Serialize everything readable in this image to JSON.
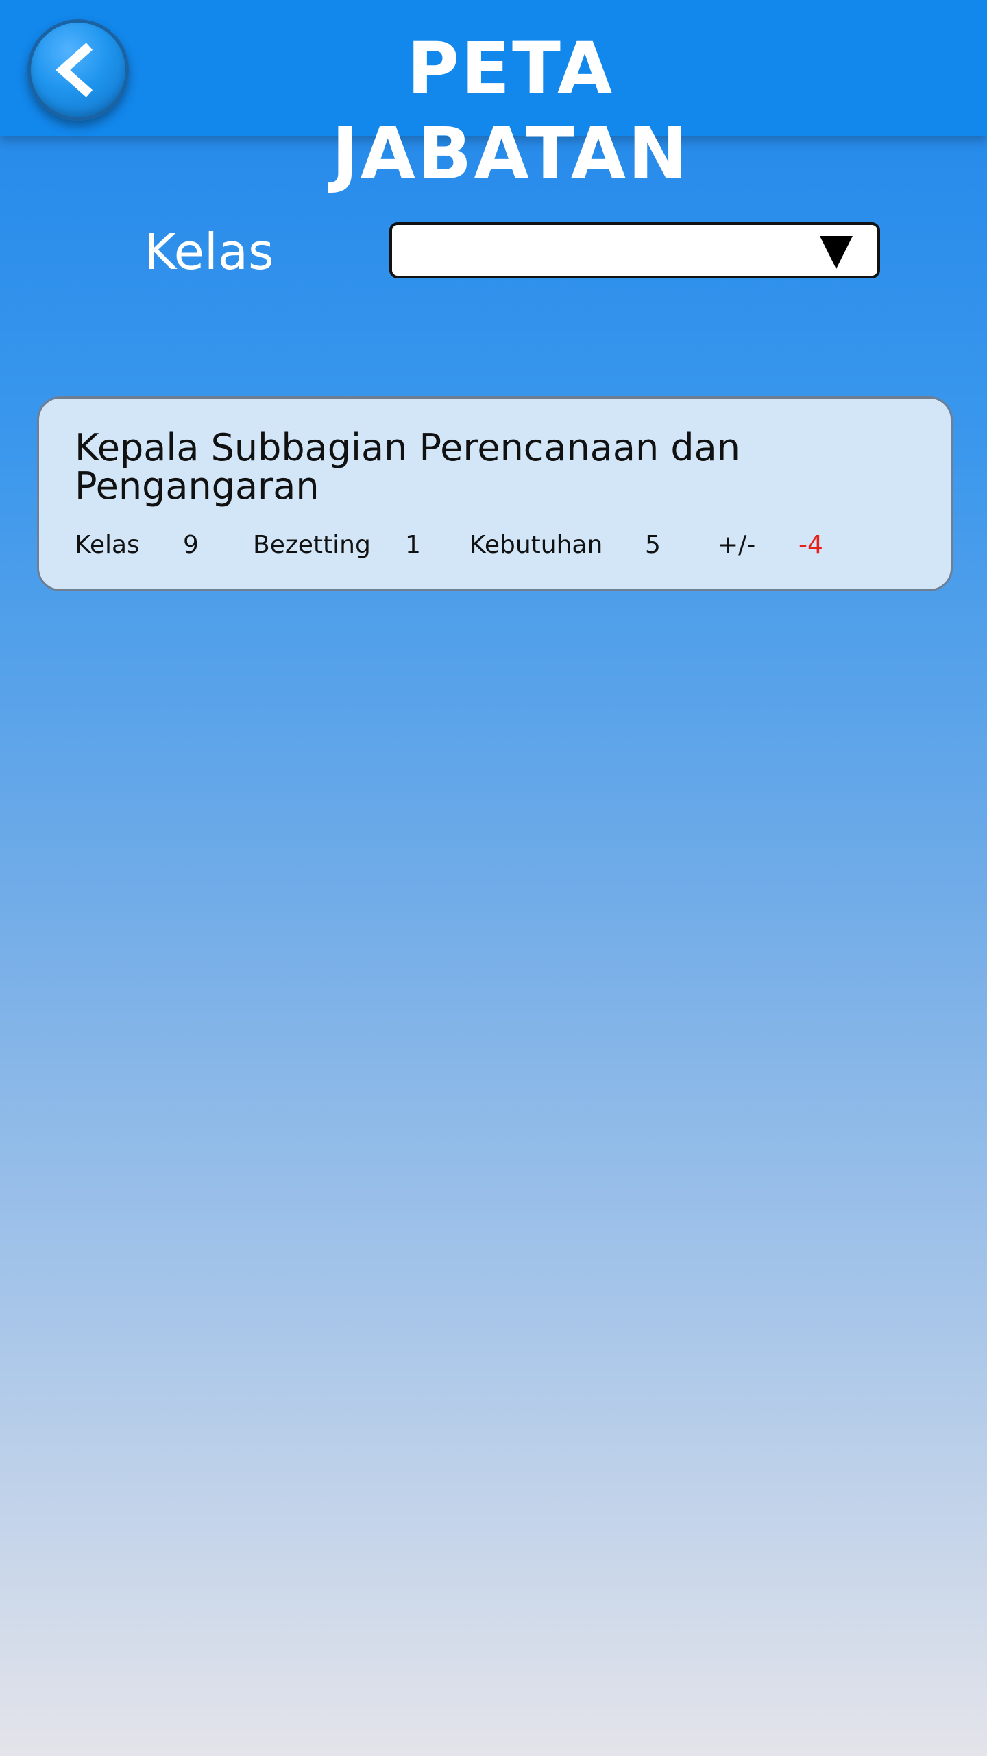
{
  "header": {
    "title": "PETA JABATAN",
    "back_icon": "chevron-left-icon",
    "background_color": "#1287ec"
  },
  "filter": {
    "label": "Kelas",
    "selected_value": "",
    "dropdown_icon": "triangle-down-icon"
  },
  "items": [
    {
      "title": "Kepala Subbagian Perencanaan dan Pengangaran",
      "kelas_label": "Kelas",
      "kelas_value": "9",
      "bezetting_label": "Bezetting",
      "bezetting_value": "1",
      "kebutuhan_label": "Kebutuhan",
      "kebutuhan_value": "5",
      "selisih_label": "+/-",
      "selisih_value": "-4",
      "selisih_color": "#e8201c"
    }
  ]
}
